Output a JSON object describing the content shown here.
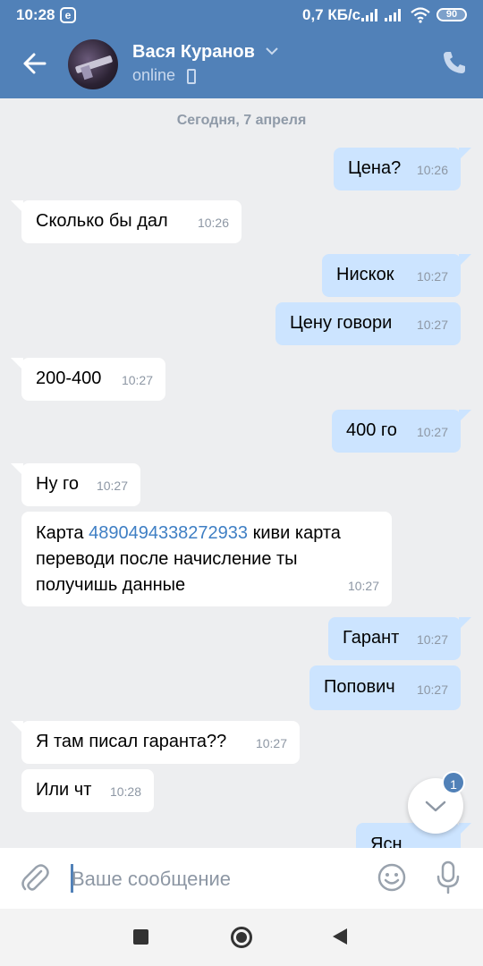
{
  "status_bar": {
    "time": "10:28",
    "notification_glyph": "e",
    "net_speed": "0,7 КБ/с",
    "battery": "90"
  },
  "header": {
    "contact_name": "Вася Куранов",
    "contact_status": "online"
  },
  "chat": {
    "date_separator": "Сегодня, 7 апреля",
    "messages": [
      {
        "dir": "out",
        "text": "Цена?",
        "time": "10:26"
      },
      {
        "dir": "in",
        "text": "Сколько бы дал",
        "time": "10:26"
      },
      {
        "dir": "out",
        "text": "Нискок",
        "time": "10:27"
      },
      {
        "dir": "out",
        "text": "Цену говори",
        "time": "10:27"
      },
      {
        "dir": "in",
        "text": "200-400",
        "time": "10:27"
      },
      {
        "dir": "out",
        "text": "400 го",
        "time": "10:27"
      },
      {
        "dir": "in",
        "text": "Ну го",
        "time": "10:27"
      },
      {
        "dir": "in",
        "text_prefix": "Карта ",
        "link": "4890494338272933",
        "text_suffix": " киви карта",
        "line2": "переводи после начисление ты",
        "line3": "получишь данные",
        "time": "10:27"
      },
      {
        "dir": "out",
        "text": "Гарант",
        "time": "10:27"
      },
      {
        "dir": "out",
        "text": "Попович",
        "time": "10:27"
      },
      {
        "dir": "in",
        "text": "Я там писал гаранта??",
        "time": "10:27"
      },
      {
        "dir": "in",
        "text": "Или чт",
        "time": "10:28"
      },
      {
        "dir": "out",
        "text": "Ясн",
        "time": ""
      }
    ],
    "unread_badge": "1"
  },
  "composer": {
    "placeholder": "Ваше сообщение"
  },
  "colors": {
    "header_bg": "#5181b8",
    "chat_bg": "#edeef0",
    "outgoing_bubble": "#cce4ff",
    "incoming_bubble": "#ffffff",
    "link": "#3f7fc4"
  },
  "icons": {
    "back": "arrow-left-icon",
    "call": "phone-icon",
    "attach": "paperclip-icon",
    "emoji": "smile-icon",
    "mic": "microphone-icon",
    "scroll_down": "chevron-down-icon"
  }
}
